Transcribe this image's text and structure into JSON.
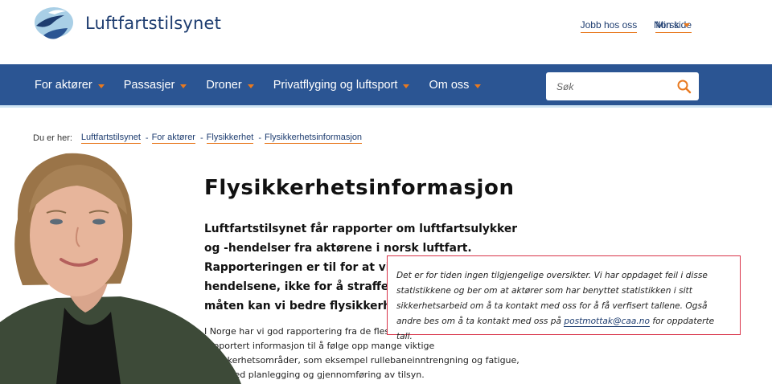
{
  "header": {
    "logo_text": "Luftfartstilsynet",
    "links": [
      {
        "label": "Jobb hos oss"
      },
      {
        "label": "Min side"
      }
    ],
    "language": "Norsk"
  },
  "nav": {
    "items": [
      {
        "label": "For aktører"
      },
      {
        "label": "Passasjer"
      },
      {
        "label": "Droner"
      },
      {
        "label": "Privatflyging og luftsport"
      },
      {
        "label": "Om oss"
      }
    ],
    "search_placeholder": "Søk"
  },
  "breadcrumb": {
    "prefix": "Du er her:",
    "items": [
      "Luftfartstilsynet",
      "For aktører",
      "Flysikkerhet",
      "Flysikkerhetsinformasjon"
    ],
    "separator": "-"
  },
  "main": {
    "title": "Flysikkerhetsinformasjon",
    "lead": "Luftfartstilsynet får rapporter om luftfartsulykker og -hendelser fra aktørene i norsk luftfart. Rapporteringen er til for at vi skal lære av hendelsene, ikke for å straffe for feil. Bare på denne måten kan vi bedre flysikkerheten.",
    "body": "I Norge har vi god rapportering fra de fleste aktørene. Vi bruker rapportert informasjon til å følge opp mange viktige flysikkerhetsområder, som eksempel rullebaneinntrengning og fatigue, samt ved planlegging og gjennomføring av tilsyn."
  },
  "notice": {
    "text_before": "Det er for tiden ingen tilgjengelige oversikter. Vi har oppdaget feil i disse statistikkene og ber om at aktører som har benyttet statistikken i sitt sikkerhetsarbeid om å ta kontakt med oss for å få verfisert tallene. Også andre bes om å ta kontakt med oss på ",
    "email": "postmottak@caa.no",
    "text_after": " for oppdaterte tall."
  },
  "colors": {
    "nav_bg": "#2b5593",
    "accent": "#e8791f",
    "brand": "#1e3d70",
    "notice_border": "#d9344a"
  }
}
